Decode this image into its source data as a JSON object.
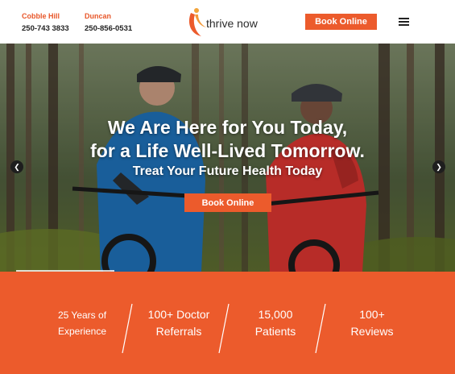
{
  "header": {
    "locations": [
      {
        "name": "Cobble Hill",
        "phone": "250-743 3833"
      },
      {
        "name": "Duncan",
        "phone": "250-856-0531"
      }
    ],
    "logo_text": "thrive now",
    "book_label": "Book Online",
    "menu_icon": "hamburger-menu-icon"
  },
  "hero": {
    "title_line1": "We Are Here for You Today,",
    "title_line2": "for a Life Well-Lived Tomorrow.",
    "subtitle": "Treat Your Future Health Today",
    "book_label": "Book Online",
    "prev_icon": "chevron-left-icon",
    "next_icon": "chevron-right-icon"
  },
  "stats": [
    {
      "line1": "25 Years of",
      "line2": "Experience"
    },
    {
      "line1": "100+ Doctor",
      "line2": "Referrals"
    },
    {
      "line1": "15,000",
      "line2": "Patients"
    },
    {
      "line1": "100+",
      "line2": "Reviews"
    }
  ],
  "colors": {
    "accent": "#ec5b2c",
    "location_label": "#e8572a",
    "text_dark": "#222222"
  }
}
